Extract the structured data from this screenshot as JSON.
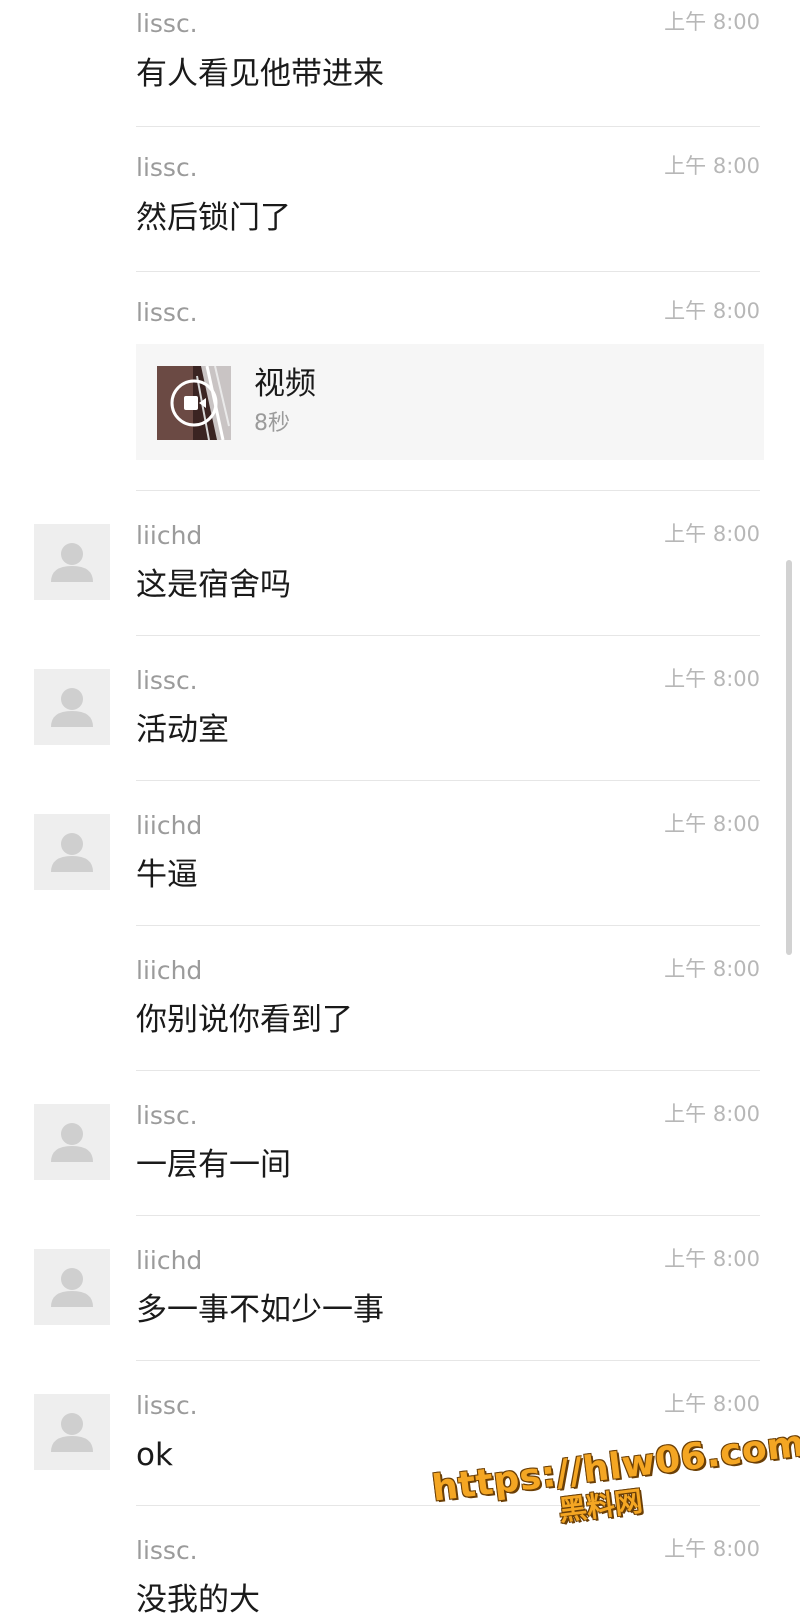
{
  "messages": [
    {
      "sender": "lissc.",
      "time": "上午 8:00",
      "text": "有人看见他带进来"
    },
    {
      "sender": "lissc.",
      "time": "上午 8:00",
      "text": "然后锁门了"
    },
    {
      "sender": "lissc.",
      "time": "上午 8:00",
      "video": {
        "label": "视频",
        "duration": "8秒"
      }
    },
    {
      "sender": "liichd",
      "time": "上午 8:00",
      "text": "这是宿舍吗"
    },
    {
      "sender": "lissc.",
      "time": "上午 8:00",
      "text": "活动室"
    },
    {
      "sender": "liichd",
      "time": "上午 8:00",
      "text": "牛逼"
    },
    {
      "sender": "liichd",
      "time": "上午 8:00",
      "text": "你别说你看到了"
    },
    {
      "sender": "lissc.",
      "time": "上午 8:00",
      "text": "一层有一间"
    },
    {
      "sender": "liichd",
      "time": "上午 8:00",
      "text": "多一事不如少一事"
    },
    {
      "sender": "lissc.",
      "time": "上午 8:00",
      "text": "ok"
    },
    {
      "sender": "lissc.",
      "time": "上午 8:00",
      "text": "没我的大"
    }
  ],
  "watermark": {
    "url": "https://hlw06.com",
    "label": "黑料网"
  },
  "icons": {
    "avatar": "default-avatar-icon",
    "video_play": "video-play-icon"
  },
  "colors": {
    "sender": "#9b9b9b",
    "time": "#b7b7b7",
    "text": "#1a1a1a",
    "divider": "#e6e6e6",
    "watermark": "#f4a623"
  }
}
